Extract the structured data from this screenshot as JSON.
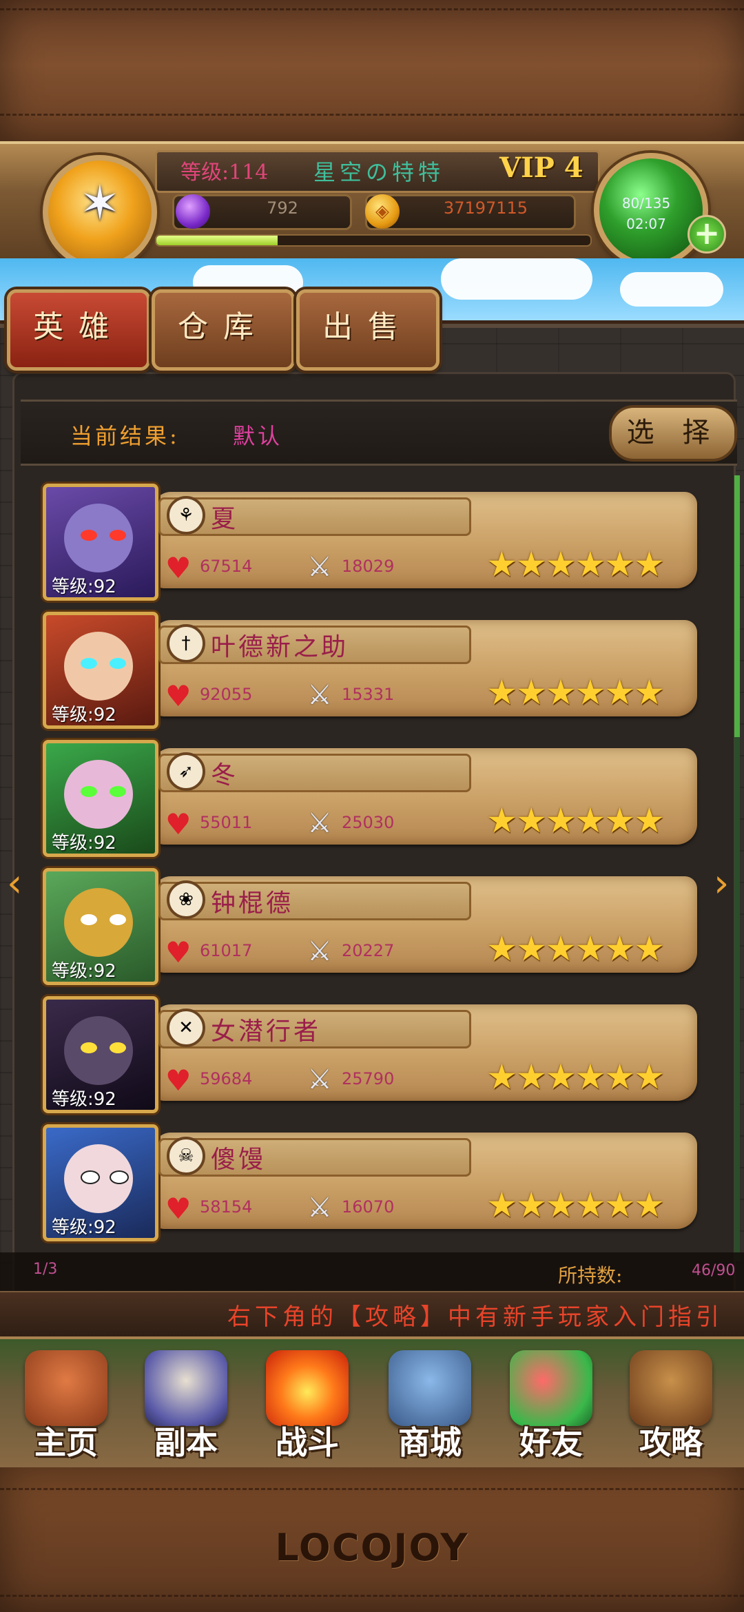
{
  "header": {
    "level": "等级:114",
    "player_name": "星空の特特",
    "vip": "VIP 4",
    "gems": "792",
    "gold": "37197115",
    "energy": "80/135",
    "energy_timer": "02:07",
    "exp_progress": 0.28
  },
  "tabs": [
    {
      "label": "英雄",
      "active": true
    },
    {
      "label": "仓库",
      "active": false
    },
    {
      "label": "出售",
      "active": false
    }
  ],
  "filter": {
    "label": "当前结果:",
    "value": "默认",
    "select_label": "选 择"
  },
  "heroes": [
    {
      "name": "夏",
      "level": "等级:92",
      "hp": "67514",
      "attack": "18029",
      "stars": 6,
      "class_icon": "claw-icon"
    },
    {
      "name": "叶德新之助",
      "level": "等级:92",
      "hp": "92055",
      "attack": "15331",
      "stars": 6,
      "class_icon": "dagger-icon"
    },
    {
      "name": "冬",
      "level": "等级:92",
      "hp": "55011",
      "attack": "25030",
      "stars": 6,
      "class_icon": "bow-icon"
    },
    {
      "name": "钟棍德",
      "level": "等级:92",
      "hp": "61017",
      "attack": "20227",
      "stars": 6,
      "class_icon": "paw-icon"
    },
    {
      "name": "女潜行者",
      "level": "等级:92",
      "hp": "59684",
      "attack": "25790",
      "stars": 6,
      "class_icon": "crossed-blades-icon"
    },
    {
      "name": "傻馒",
      "level": "等级:92",
      "hp": "58154",
      "attack": "16070",
      "stars": 6,
      "class_icon": "skull-icon"
    }
  ],
  "list_footer": {
    "page": "1/3",
    "owned_label": "所持数:",
    "owned_value": "46/90"
  },
  "ticker": "右下角的【攻略】中有新手玩家入门指引",
  "nav": [
    {
      "label": "主页",
      "icon": "house-icon"
    },
    {
      "label": "副本",
      "icon": "skull-orb-icon"
    },
    {
      "label": "战斗",
      "icon": "sword-shield-icon"
    },
    {
      "label": "商城",
      "icon": "monster-shop-icon"
    },
    {
      "label": "好友",
      "icon": "friends-icon"
    },
    {
      "label": "攻略",
      "icon": "book-icon"
    }
  ],
  "brand": "LOCOJOY",
  "colors": {
    "hero_name": "#9a1e4a",
    "stat_value": "#b03060",
    "ticker": "#e8442a",
    "filter_label": "#f0a030",
    "filter_value": "#e040a0"
  }
}
